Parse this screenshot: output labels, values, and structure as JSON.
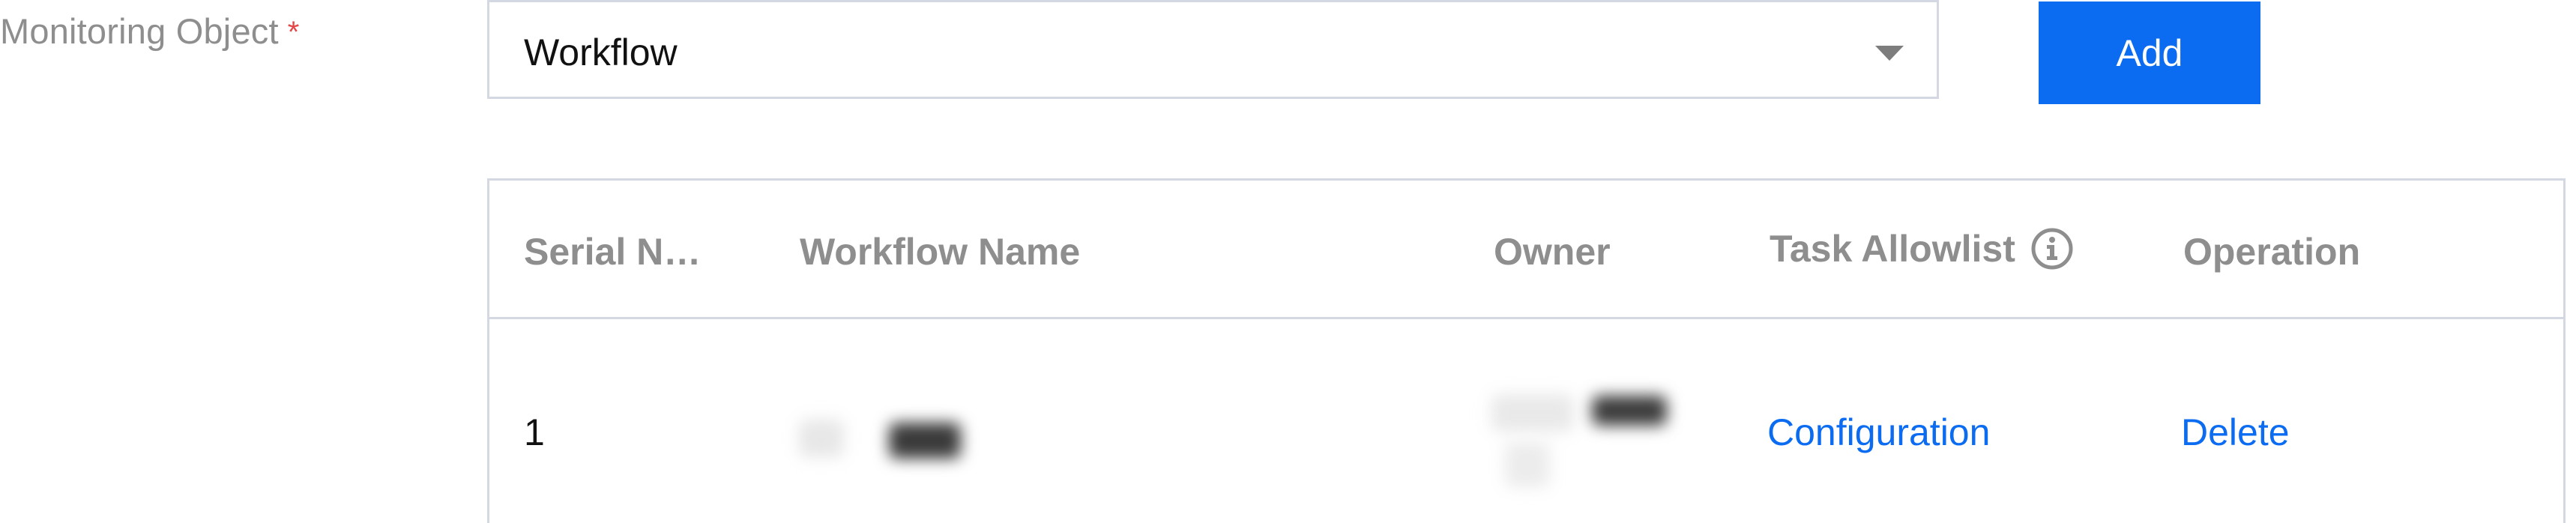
{
  "form": {
    "label": "Monitoring Object",
    "required_mark": "*",
    "select_value": "Workflow",
    "add_button": "Add"
  },
  "table": {
    "columns": [
      "Serial N…",
      "Workflow Name",
      "Owner",
      "Task Allowlist",
      "Operation"
    ],
    "rows": [
      {
        "serial": "1",
        "actions": {
          "configuration": "Configuration",
          "delete": "Delete"
        }
      }
    ]
  },
  "icons": {
    "select_caret": "chevron-down-icon",
    "task_allowlist_info": "info-icon"
  },
  "colors": {
    "accent": "#0b6cf2",
    "required": "#e54545",
    "border": "#d4d8e2",
    "header_text": "#8e8e8e"
  }
}
